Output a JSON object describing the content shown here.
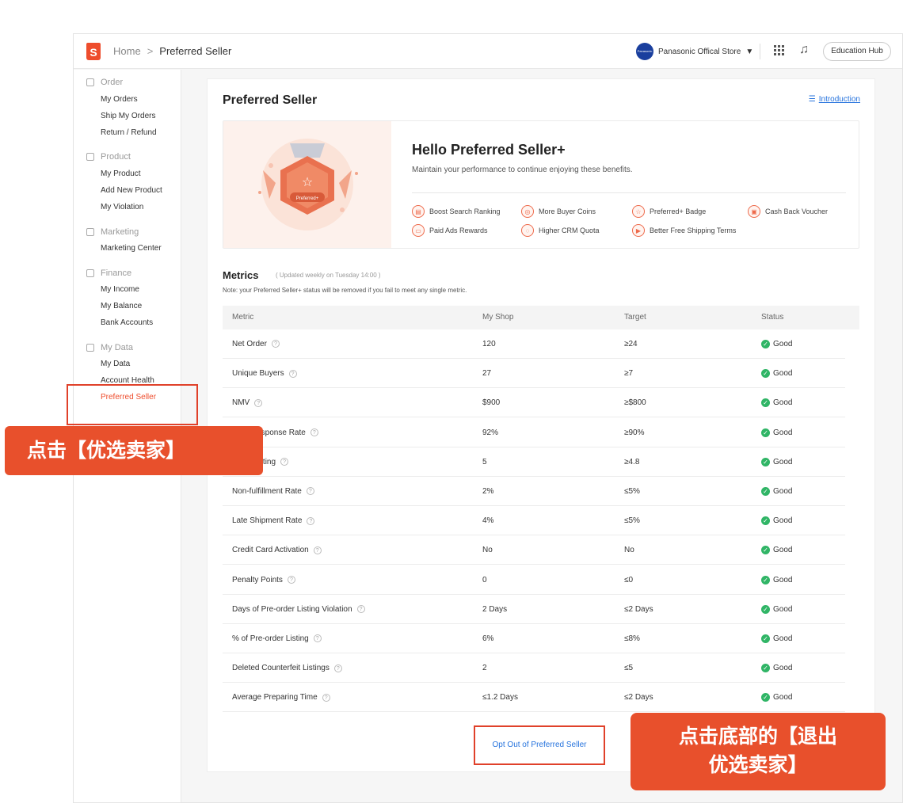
{
  "header": {
    "logo_letter": "S",
    "breadcrumb": {
      "home": "Home",
      "separator": ">",
      "current": "Preferred Seller"
    },
    "store_avatar_text": "Panasonic",
    "store_name": "Panasonic Offical Store",
    "education_hub": "Education Hub"
  },
  "sidebar": {
    "sections": [
      {
        "title": "Order",
        "items": [
          "My Orders",
          "Ship My Orders",
          "Return / Refund"
        ]
      },
      {
        "title": "Product",
        "items": [
          "My Product",
          "Add New Product",
          "My Violation"
        ]
      },
      {
        "title": "Marketing",
        "items": [
          "Marketing Center"
        ]
      },
      {
        "title": "Finance",
        "items": [
          "My Income",
          "My Balance",
          "Bank Accounts"
        ]
      },
      {
        "title": "My Data",
        "items": [
          "My Data",
          "Account Health",
          "Preferred Seller"
        ]
      }
    ],
    "active_item": "Preferred Seller"
  },
  "main": {
    "title": "Preferred Seller",
    "introduction_link": "Introduction",
    "banner": {
      "badge_label": "Preferred+",
      "hello": "Hello Preferred Seller+",
      "subtitle": "Maintain your performance to continue enjoying these benefits.",
      "benefits": [
        "Boost Search Ranking",
        "More Buyer Coins",
        "Preferred+ Badge",
        "Cash Back Voucher",
        "Paid Ads Rewards",
        "Higher CRM Quota",
        "Better Free Shipping Terms"
      ]
    },
    "metrics": {
      "title": "Metrics",
      "updated": "( Updated weekly on Tuesday 14:00 )",
      "note": "Note: your Preferred Seller+ status will be removed if you fail to meet any single metric.",
      "columns": [
        "Metric",
        "My Shop",
        "Target",
        "Status"
      ],
      "rows": [
        {
          "metric": "Net Order",
          "shop": "120",
          "target": "≥24",
          "status": "Good"
        },
        {
          "metric": "Unique Buyers",
          "shop": "27",
          "target": "≥7",
          "status": "Good"
        },
        {
          "metric": "NMV",
          "shop": "$900",
          "target": "≥$800",
          "status": "Good"
        },
        {
          "metric": "Chat Response Rate",
          "shop": "92%",
          "target": "≥90%",
          "status": "Good"
        },
        {
          "metric": "Shop Rating",
          "shop": "5",
          "target": "≥4.8",
          "status": "Good"
        },
        {
          "metric": "Non-fulfillment Rate",
          "shop": "2%",
          "target": "≤5%",
          "status": "Good"
        },
        {
          "metric": "Late Shipment Rate",
          "shop": "4%",
          "target": "≤5%",
          "status": "Good"
        },
        {
          "metric": "Credit Card Activation",
          "shop": "No",
          "target": "No",
          "status": "Good"
        },
        {
          "metric": "Penalty Points",
          "shop": "0",
          "target": "≤0",
          "status": "Good"
        },
        {
          "metric": "Days of Pre-order Listing Violation",
          "shop": "2 Days",
          "target": "≤2 Days",
          "status": "Good"
        },
        {
          "metric": "% of Pre-order Listing",
          "shop": "6%",
          "target": "≤8%",
          "status": "Good"
        },
        {
          "metric": "Deleted Counterfeit Listings",
          "shop": "2",
          "target": "≤5",
          "status": "Good"
        },
        {
          "metric": "Average Preparing Time",
          "shop": "≤1.2 Days",
          "target": "≤2 Days",
          "status": "Good"
        }
      ]
    },
    "opt_out": "Opt Out of Preferred Seller"
  },
  "annotations": {
    "callout_sidebar": "点击【优选卖家】",
    "callout_bottom_line1": "点击底部的【退出",
    "callout_bottom_line2": "优选卖家】"
  },
  "colors": {
    "accent": "#ee4d2d",
    "callout": "#e8502c",
    "link": "#2673dd",
    "good": "#30b566"
  }
}
